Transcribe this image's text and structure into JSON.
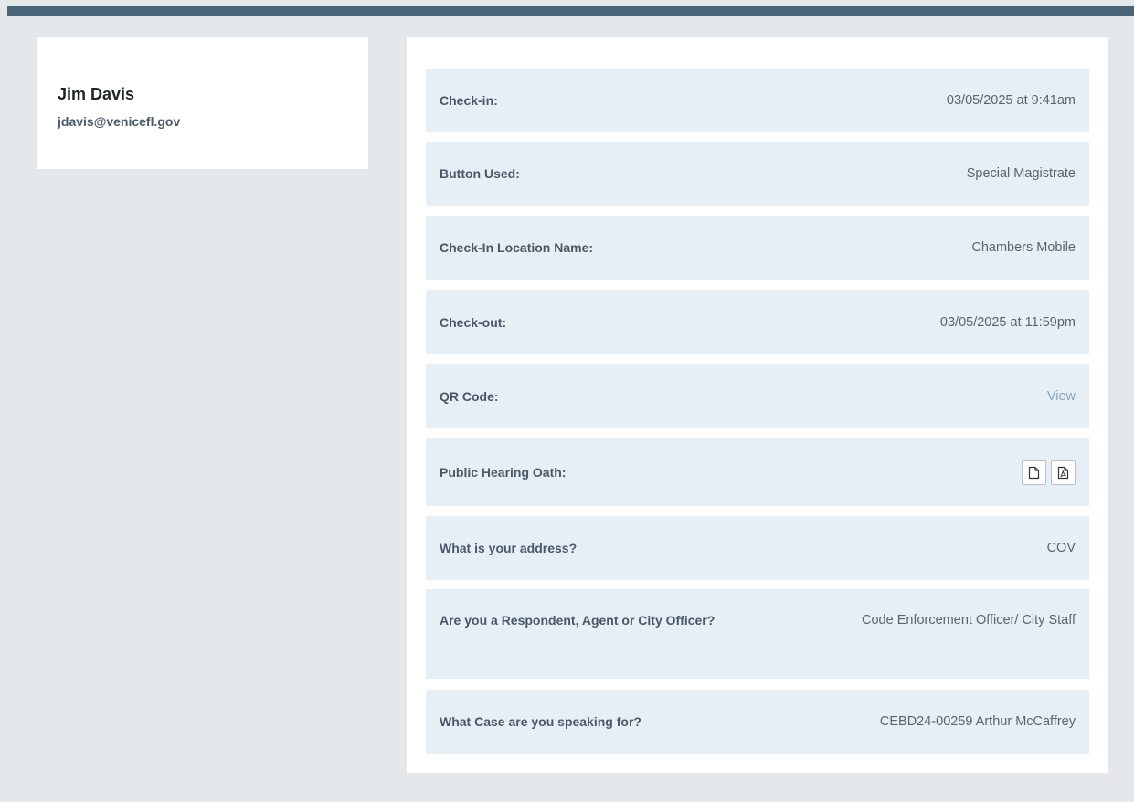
{
  "user": {
    "name": "Jim Davis",
    "email": "jdavis@venicefl.gov"
  },
  "details": [
    {
      "label": "Check-in:",
      "value": "03/05/2025 at 9:41am"
    },
    {
      "label": "Button Used:",
      "value": "Special Magistrate"
    },
    {
      "label": "Check-In Location Name:",
      "value": "Chambers Mobile"
    },
    {
      "label": "Check-out:",
      "value": "03/05/2025 at 11:59pm"
    },
    {
      "label": "QR Code:",
      "link": "View"
    },
    {
      "label": "Public Hearing Oath:",
      "icons": [
        "document-icon",
        "pdf-icon"
      ]
    },
    {
      "label": "What is your address?",
      "value": "COV"
    },
    {
      "label": "Are you a Respondent, Agent or City Officer?",
      "value": "Code Enforcement Officer/ City Staff"
    },
    {
      "label": "What Case are you speaking for?",
      "value": "CEBD24-00259 Arthur McCaffrey"
    }
  ],
  "colors": {
    "top_bar": "#4a6478",
    "background": "#e4e8eb",
    "row_background": "#e6eef6",
    "link": "#8aa6bd"
  }
}
